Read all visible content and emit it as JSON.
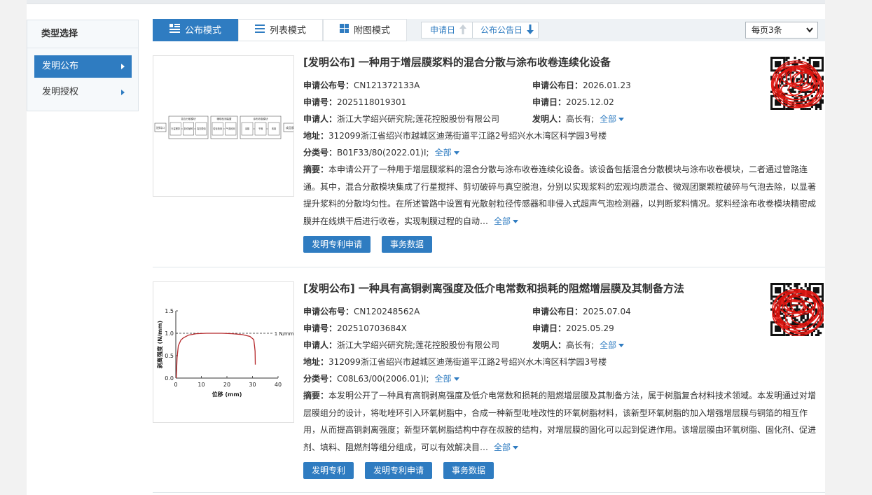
{
  "sidebar": {
    "title": "类型选择",
    "items": [
      {
        "label": "发明公布",
        "active": true
      },
      {
        "label": "发明授权",
        "active": false
      }
    ]
  },
  "toolbar": {
    "modes": [
      {
        "label": "公布模式",
        "icon": "list-detail-icon",
        "active": true
      },
      {
        "label": "列表模式",
        "icon": "list-icon",
        "active": false
      },
      {
        "label": "附图模式",
        "icon": "grid-icon",
        "active": false
      }
    ],
    "sort": [
      {
        "label": "申请日",
        "icon": "arrow-up-icon"
      },
      {
        "label": "公布公告日",
        "icon": "arrow-down-icon"
      }
    ],
    "per_page": "每页3条"
  },
  "labels": {
    "pub_no": "申请公布号：",
    "pub_date": "申请公布日：",
    "app_no": "申请号：",
    "app_date": "申请日：",
    "applicant": "申请人：",
    "inventor": "发明人：",
    "address": "地址：",
    "ipc": "分类号：",
    "abstract": "摘要：",
    "more": "全部"
  },
  "records": [
    {
      "title": "[发明公布] 一种用于增层膜浆料的混合分散与涂布收卷连续化设备",
      "pub_no": "CN121372133A",
      "pub_date": "2026.01.23",
      "app_no": "2025118019301",
      "app_date": "2025.12.02",
      "applicant": "浙江大学绍兴研究院;莲花控股股份有限公司",
      "inventor": "高长有;",
      "address": "312099浙江省绍兴市越城区迪荡街道平江路2号绍兴水木湾区科学园3号楼",
      "ipc": "B01F33/80(2022.01)I;",
      "abstract": "本申请公开了一种用于增层膜浆料的混合分散与涂布收卷连续化设备。该设备包括混合分散模块与涂布收卷模块，二者通过管路连通。其中，混合分散模块集成了行星搅拌、剪切破碎与真空脱泡，分别以实现浆料的宏观均质混合、微观团聚颗粒破碎与气泡去除，以显著提升浆料的分散均匀性。在所述管路中设置有光散射粒径传感器和非侵入式超声气泡检测器，以判断浆料情况。浆料经涂布收卷模块精密成膜并在线烘干后进行收卷，实现制膜过程的自动…",
      "buttons": [
        "发明专利申请",
        "事务数据"
      ],
      "diagram": {
        "modules": [
          {
            "title": "混合分散模块",
            "blocks": [
              "行星搅拌",
              "剪切破碎",
              "真空脱泡"
            ]
          },
          {
            "title": "辅助检测装置",
            "blocks": [
              "粒径检测",
              "气泡检测"
            ]
          },
          {
            "title": "涂布收卷模块",
            "blocks": [
              "涂膜",
              "干燥",
              "收卷"
            ]
          }
        ],
        "input": "进料口",
        "output": "成品膜"
      }
    },
    {
      "title": "[发明公布] 一种具有高铜剥离强度及低介电常数和损耗的阻燃增层膜及其制备方法",
      "pub_no": "CN120248562A",
      "pub_date": "2025.07.04",
      "app_no": "202510703684X",
      "app_date": "2025.05.29",
      "applicant": "浙江大学绍兴研究院;莲花控股股份有限公司",
      "inventor": "高长有;",
      "address": "312099浙江省绍兴市越城区迪荡街道平江路2号绍兴水木湾区科学园3号楼",
      "ipc": "C08L63/00(2006.01)I;",
      "abstract": "本发明公开了一种具有高铜剥离强度及低介电常数和损耗的阻燃增层膜及其制备方法，属于树脂复合材料技术领域。本发明通过对增层膜组分的设计，将吡唑环引入环氧树脂中，合成一种新型吡唑改性的环氧树脂材料，该新型环氧树脂的加入增强增层膜与铜箔的相互作用，从而提高铜剥离强度；新型环氧树脂结构中存在叔胺的结构，对增层膜的固化可以起到促进作用。该增层膜由环氧树脂、固化剂、促进剂、填料、阻燃剂等组分组成，可以有效解决目…",
      "buttons": [
        "发明专利",
        "发明专利申请",
        "事务数据"
      ],
      "figure": {
        "ylabel": "剥离强度 (N/mm)",
        "xlabel": "位移 (mm)",
        "yticks": [
          "0.0",
          "0.5",
          "1.0",
          "1.5"
        ],
        "xticks": [
          "0",
          "10",
          "20",
          "30",
          "40"
        ],
        "ref_label": "1 N/mm",
        "curve": [
          [
            0.2,
            0.0
          ],
          [
            0.5,
            0.45
          ],
          [
            1,
            0.72
          ],
          [
            2,
            0.85
          ],
          [
            3,
            0.9
          ],
          [
            5,
            0.96
          ],
          [
            8,
            0.99
          ],
          [
            12,
            1.0
          ],
          [
            18,
            1.0
          ],
          [
            22,
            0.99
          ],
          [
            26,
            0.97
          ],
          [
            29,
            0.93
          ],
          [
            30.5,
            0.86
          ],
          [
            30.8,
            0.72
          ],
          [
            31,
            0.6
          ],
          [
            31.1,
            0.3
          ]
        ]
      }
    }
  ]
}
